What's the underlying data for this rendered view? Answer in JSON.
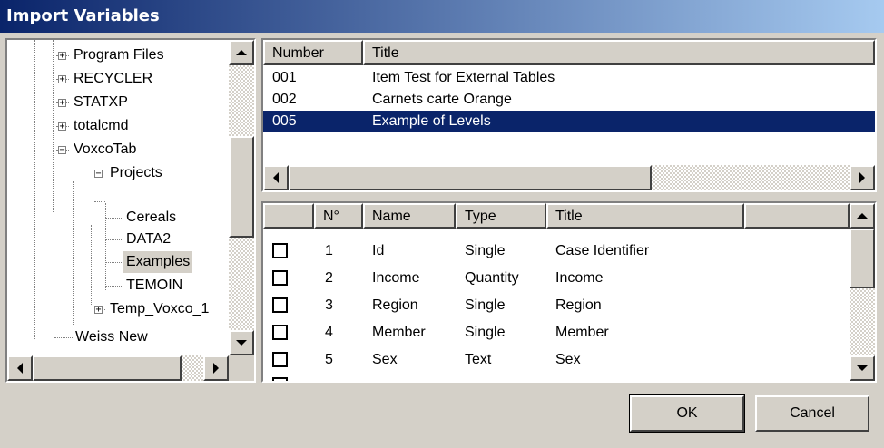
{
  "window": {
    "title": "Import Variables"
  },
  "tree": {
    "items": [
      {
        "label": "Program Files",
        "expander": "+"
      },
      {
        "label": "RECYCLER",
        "expander": "+"
      },
      {
        "label": "STATXP",
        "expander": "+"
      },
      {
        "label": "totalcmd",
        "expander": "+"
      },
      {
        "label": "VoxcoTab",
        "expander": "−"
      },
      {
        "label": "Projects",
        "expander": "−"
      },
      {
        "label": "Cereals"
      },
      {
        "label": "DATA2"
      },
      {
        "label": "Examples"
      },
      {
        "label": "TEMOIN"
      },
      {
        "label": "Temp_Voxco_1",
        "expander": "+"
      },
      {
        "label": "Weiss New"
      }
    ]
  },
  "tables_list": {
    "headers": {
      "number": "Number",
      "title": "Title"
    },
    "rows": [
      {
        "number": "001",
        "title": "Item Test for External Tables"
      },
      {
        "number": "002",
        "title": "Carnets carte Orange"
      },
      {
        "number": "005",
        "title": "Example of Levels"
      }
    ]
  },
  "variables": {
    "headers": {
      "check": "",
      "num": "N°",
      "name": "Name",
      "type": "Type",
      "title": "Title"
    },
    "rows": [
      {
        "num": "1",
        "name": "Id",
        "type": "Single",
        "title": "Case Identifier"
      },
      {
        "num": "2",
        "name": "Income",
        "type": "Quantity",
        "title": "Income"
      },
      {
        "num": "3",
        "name": "Region",
        "type": "Single",
        "title": "Region"
      },
      {
        "num": "4",
        "name": "Member",
        "type": "Single",
        "title": "Member"
      },
      {
        "num": "5",
        "name": "Sex",
        "type": "Text",
        "title": "Sex"
      }
    ]
  },
  "buttons": {
    "ok": "OK",
    "cancel": "Cancel"
  }
}
